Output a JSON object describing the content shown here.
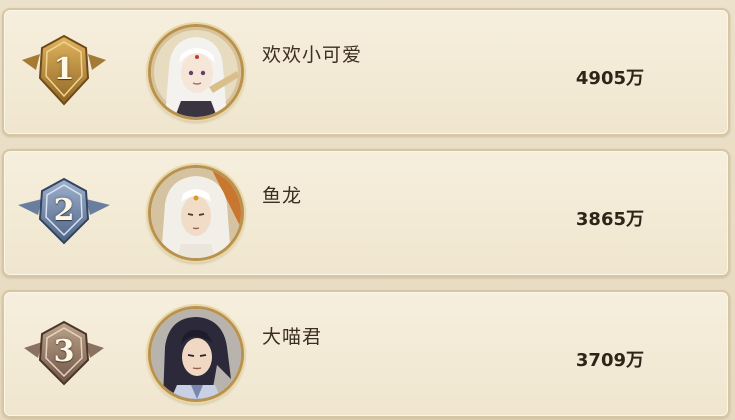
{
  "leaderboard": {
    "entries": [
      {
        "rank": "1",
        "badge_color": "#b9893a",
        "name": "欢欢小可爱",
        "score": "4905万",
        "avatar_icon": "white-haired-girl-avatar-icon"
      },
      {
        "rank": "2",
        "badge_color": "#6f86a8",
        "name": "鱼龙",
        "score": "3865万",
        "avatar_icon": "white-haired-man-avatar-icon"
      },
      {
        "rank": "3",
        "badge_color": "#a08672",
        "name": "大喵君",
        "score": "3709万",
        "avatar_icon": "dark-haired-man-avatar-icon"
      }
    ]
  }
}
